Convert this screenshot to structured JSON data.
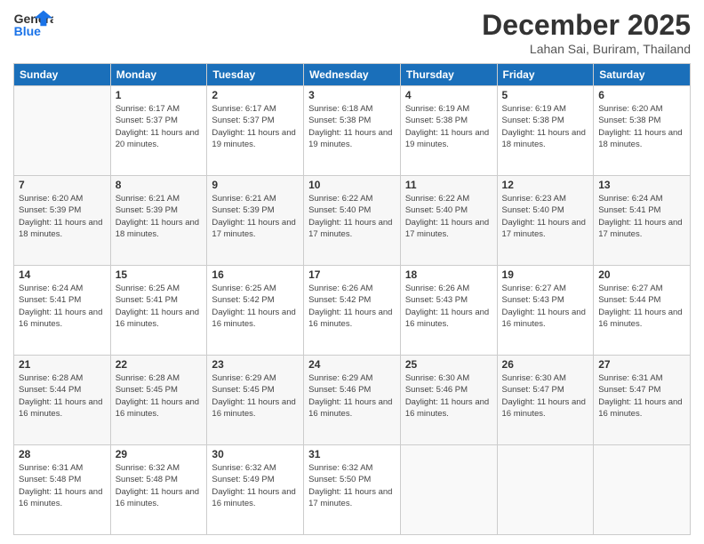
{
  "header": {
    "logo": {
      "line1": "General",
      "line2": "Blue"
    },
    "title": "December 2025",
    "location": "Lahan Sai, Buriram, Thailand"
  },
  "weekdays": [
    "Sunday",
    "Monday",
    "Tuesday",
    "Wednesday",
    "Thursday",
    "Friday",
    "Saturday"
  ],
  "weeks": [
    [
      {
        "day": "",
        "info": ""
      },
      {
        "day": "1",
        "sunrise": "Sunrise: 6:17 AM",
        "sunset": "Sunset: 5:37 PM",
        "daylight": "Daylight: 11 hours and 20 minutes."
      },
      {
        "day": "2",
        "sunrise": "Sunrise: 6:17 AM",
        "sunset": "Sunset: 5:37 PM",
        "daylight": "Daylight: 11 hours and 19 minutes."
      },
      {
        "day": "3",
        "sunrise": "Sunrise: 6:18 AM",
        "sunset": "Sunset: 5:38 PM",
        "daylight": "Daylight: 11 hours and 19 minutes."
      },
      {
        "day": "4",
        "sunrise": "Sunrise: 6:19 AM",
        "sunset": "Sunset: 5:38 PM",
        "daylight": "Daylight: 11 hours and 19 minutes."
      },
      {
        "day": "5",
        "sunrise": "Sunrise: 6:19 AM",
        "sunset": "Sunset: 5:38 PM",
        "daylight": "Daylight: 11 hours and 18 minutes."
      },
      {
        "day": "6",
        "sunrise": "Sunrise: 6:20 AM",
        "sunset": "Sunset: 5:38 PM",
        "daylight": "Daylight: 11 hours and 18 minutes."
      }
    ],
    [
      {
        "day": "7",
        "sunrise": "Sunrise: 6:20 AM",
        "sunset": "Sunset: 5:39 PM",
        "daylight": "Daylight: 11 hours and 18 minutes."
      },
      {
        "day": "8",
        "sunrise": "Sunrise: 6:21 AM",
        "sunset": "Sunset: 5:39 PM",
        "daylight": "Daylight: 11 hours and 18 minutes."
      },
      {
        "day": "9",
        "sunrise": "Sunrise: 6:21 AM",
        "sunset": "Sunset: 5:39 PM",
        "daylight": "Daylight: 11 hours and 17 minutes."
      },
      {
        "day": "10",
        "sunrise": "Sunrise: 6:22 AM",
        "sunset": "Sunset: 5:40 PM",
        "daylight": "Daylight: 11 hours and 17 minutes."
      },
      {
        "day": "11",
        "sunrise": "Sunrise: 6:22 AM",
        "sunset": "Sunset: 5:40 PM",
        "daylight": "Daylight: 11 hours and 17 minutes."
      },
      {
        "day": "12",
        "sunrise": "Sunrise: 6:23 AM",
        "sunset": "Sunset: 5:40 PM",
        "daylight": "Daylight: 11 hours and 17 minutes."
      },
      {
        "day": "13",
        "sunrise": "Sunrise: 6:24 AM",
        "sunset": "Sunset: 5:41 PM",
        "daylight": "Daylight: 11 hours and 17 minutes."
      }
    ],
    [
      {
        "day": "14",
        "sunrise": "Sunrise: 6:24 AM",
        "sunset": "Sunset: 5:41 PM",
        "daylight": "Daylight: 11 hours and 16 minutes."
      },
      {
        "day": "15",
        "sunrise": "Sunrise: 6:25 AM",
        "sunset": "Sunset: 5:41 PM",
        "daylight": "Daylight: 11 hours and 16 minutes."
      },
      {
        "day": "16",
        "sunrise": "Sunrise: 6:25 AM",
        "sunset": "Sunset: 5:42 PM",
        "daylight": "Daylight: 11 hours and 16 minutes."
      },
      {
        "day": "17",
        "sunrise": "Sunrise: 6:26 AM",
        "sunset": "Sunset: 5:42 PM",
        "daylight": "Daylight: 11 hours and 16 minutes."
      },
      {
        "day": "18",
        "sunrise": "Sunrise: 6:26 AM",
        "sunset": "Sunset: 5:43 PM",
        "daylight": "Daylight: 11 hours and 16 minutes."
      },
      {
        "day": "19",
        "sunrise": "Sunrise: 6:27 AM",
        "sunset": "Sunset: 5:43 PM",
        "daylight": "Daylight: 11 hours and 16 minutes."
      },
      {
        "day": "20",
        "sunrise": "Sunrise: 6:27 AM",
        "sunset": "Sunset: 5:44 PM",
        "daylight": "Daylight: 11 hours and 16 minutes."
      }
    ],
    [
      {
        "day": "21",
        "sunrise": "Sunrise: 6:28 AM",
        "sunset": "Sunset: 5:44 PM",
        "daylight": "Daylight: 11 hours and 16 minutes."
      },
      {
        "day": "22",
        "sunrise": "Sunrise: 6:28 AM",
        "sunset": "Sunset: 5:45 PM",
        "daylight": "Daylight: 11 hours and 16 minutes."
      },
      {
        "day": "23",
        "sunrise": "Sunrise: 6:29 AM",
        "sunset": "Sunset: 5:45 PM",
        "daylight": "Daylight: 11 hours and 16 minutes."
      },
      {
        "day": "24",
        "sunrise": "Sunrise: 6:29 AM",
        "sunset": "Sunset: 5:46 PM",
        "daylight": "Daylight: 11 hours and 16 minutes."
      },
      {
        "day": "25",
        "sunrise": "Sunrise: 6:30 AM",
        "sunset": "Sunset: 5:46 PM",
        "daylight": "Daylight: 11 hours and 16 minutes."
      },
      {
        "day": "26",
        "sunrise": "Sunrise: 6:30 AM",
        "sunset": "Sunset: 5:47 PM",
        "daylight": "Daylight: 11 hours and 16 minutes."
      },
      {
        "day": "27",
        "sunrise": "Sunrise: 6:31 AM",
        "sunset": "Sunset: 5:47 PM",
        "daylight": "Daylight: 11 hours and 16 minutes."
      }
    ],
    [
      {
        "day": "28",
        "sunrise": "Sunrise: 6:31 AM",
        "sunset": "Sunset: 5:48 PM",
        "daylight": "Daylight: 11 hours and 16 minutes."
      },
      {
        "day": "29",
        "sunrise": "Sunrise: 6:32 AM",
        "sunset": "Sunset: 5:48 PM",
        "daylight": "Daylight: 11 hours and 16 minutes."
      },
      {
        "day": "30",
        "sunrise": "Sunrise: 6:32 AM",
        "sunset": "Sunset: 5:49 PM",
        "daylight": "Daylight: 11 hours and 16 minutes."
      },
      {
        "day": "31",
        "sunrise": "Sunrise: 6:32 AM",
        "sunset": "Sunset: 5:50 PM",
        "daylight": "Daylight: 11 hours and 17 minutes."
      },
      {
        "day": "",
        "info": ""
      },
      {
        "day": "",
        "info": ""
      },
      {
        "day": "",
        "info": ""
      }
    ]
  ]
}
